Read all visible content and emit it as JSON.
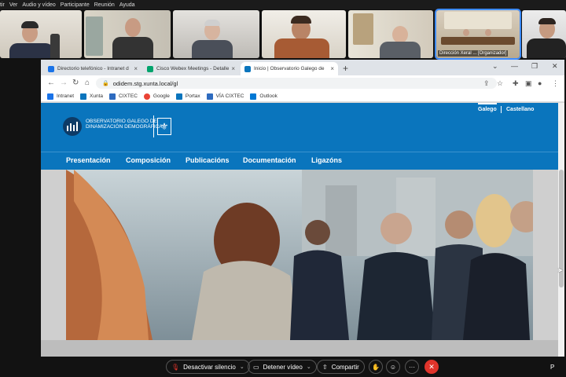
{
  "menu": [
    "tir",
    "Ver",
    "Audio y vídeo",
    "Participante",
    "Reunión",
    "Ayuda"
  ],
  "participants": {
    "active_label": "Dirección Xeral ... [Organizador]"
  },
  "browser": {
    "tabs": [
      {
        "label": "Directorio telefónico - Intranet d",
        "favicon_color": "#1a73e8"
      },
      {
        "label": "Cisco Webex Meetings - Detalle",
        "favicon_color": "#00a36c"
      },
      {
        "label": "Inicio | Observatorio Galego de",
        "favicon_color": "#0a75bd"
      }
    ],
    "new_tab": "+",
    "url": "odidem.stg.xunta.local/gl",
    "bookmarks": [
      "Intranet",
      "Xunta",
      "CIXTEC",
      "Google",
      "Portax",
      "VÍA CIXTEC",
      "Outlook"
    ]
  },
  "site": {
    "logo_text": "OBSERVATORIO GALEGO DE DINAMIZACIÓN DEMOGRÁFICA",
    "lang": [
      "Galego",
      "Castellano"
    ],
    "nav": [
      "Presentación",
      "Composición",
      "Publicacións",
      "Documentación",
      "Ligazóns"
    ]
  },
  "controls": {
    "mute": "Desactivar silencio",
    "video": "Detener vídeo",
    "share": "Compartir",
    "more": "···",
    "end": "✕",
    "participants_short": "P"
  },
  "colors": {
    "site_blue": "#0a75bd",
    "end_red": "#e0342b",
    "active_outline": "#3d8bff"
  }
}
